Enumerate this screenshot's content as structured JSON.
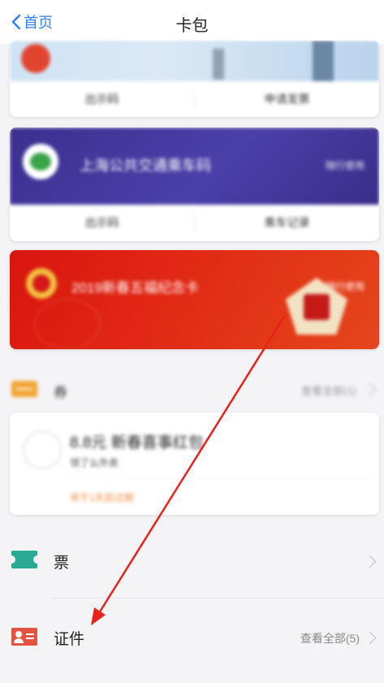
{
  "nav": {
    "back_label": "首页",
    "title": "卡包"
  },
  "cards": [
    {
      "title": "",
      "actions": [
        "出示码",
        "申请发票"
      ]
    },
    {
      "title": "上海公共交通乘车码",
      "tag": "随行使用",
      "actions": [
        "出示码",
        "乘车记录"
      ]
    },
    {
      "title": "2019新春五福纪念卡",
      "tag": "随行使用"
    }
  ],
  "coupons": {
    "label": "券",
    "more": "查看全部(1)",
    "item": {
      "name": "8.8元 新春喜事红包",
      "sub": "领了么外卖",
      "warn": "将于1天后过期"
    }
  },
  "tickets": {
    "label": "票"
  },
  "certificates": {
    "label": "证件",
    "more": "查看全部(5)"
  },
  "colors": {
    "accent": "#2d7ff9",
    "annotation_arrow": "#e8221b"
  }
}
